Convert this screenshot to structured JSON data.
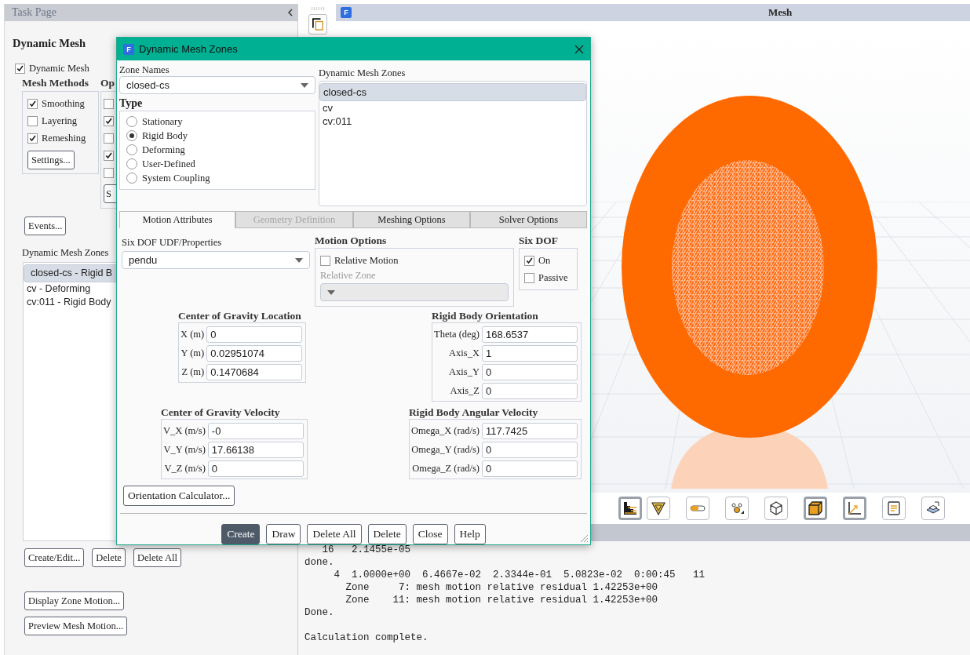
{
  "task_page": {
    "title": "Task Page",
    "heading": "Dynamic Mesh",
    "dynamic_mesh": {
      "label": "Dynamic Mesh",
      "checked": true
    },
    "mesh_methods": {
      "title": "Mesh Methods",
      "items": [
        {
          "label": "Smoothing",
          "checked": true
        },
        {
          "label": "Layering",
          "checked": false
        },
        {
          "label": "Remeshing",
          "checked": true
        }
      ],
      "button": "Settings..."
    },
    "options": {
      "title": "Op",
      "items": [
        {
          "checked": false
        },
        {
          "checked": true
        },
        {
          "checked": false
        },
        {
          "checked": true
        },
        {
          "checked": false
        }
      ],
      "button": "S"
    },
    "events_button": "Events...",
    "zones_label": "Dynamic Mesh Zones",
    "zones": [
      {
        "label": "closed-cs - Rigid B",
        "selected": true
      },
      {
        "label": "cv - Deforming",
        "selected": false
      },
      {
        "label": "cv:011 - Rigid Body",
        "selected": false
      }
    ],
    "zone_buttons": [
      "Create/Edit...",
      "Delete",
      "Delete All"
    ],
    "motion_buttons": [
      "Display Zone Motion...",
      "Preview Mesh Motion..."
    ]
  },
  "graphics": {
    "logo": "F",
    "title": "Mesh",
    "toolbar": [
      {
        "kind": "mesh",
        "selected": true
      },
      {
        "kind": "contour",
        "selected": false
      },
      {
        "kind": "slider",
        "selected": false
      },
      {
        "kind": "nodes",
        "selected": false
      },
      {
        "kind": "cube",
        "selected": false
      },
      {
        "kind": "box",
        "selected": true
      },
      {
        "kind": "axes",
        "selected": true
      },
      {
        "kind": "note",
        "selected": false
      },
      {
        "kind": "layers",
        "selected": false
      }
    ]
  },
  "console": {
    "blocks": [
      {
        "lines": [
          "   16   2.1455e-05",
          "done.",
          "     4  1.0000e+00  6.4667e-02  2.3344e-01  5.0823e-02  0:00:45   11",
          "       Zone     7: mesh motion relative residual 1.42253e+00",
          "       Zone    11: mesh motion relative residual 1.42253e+00",
          "Done."
        ]
      },
      {
        "lines": [
          "Calculation complete."
        ]
      }
    ]
  },
  "dialog": {
    "logo": "F",
    "title": "Dynamic Mesh Zones",
    "zone_names": {
      "label": "Zone Names",
      "value": "closed-cs"
    },
    "type": {
      "title": "Type",
      "options": [
        {
          "label": "Stationary",
          "selected": false
        },
        {
          "label": "Rigid Body",
          "selected": true
        },
        {
          "label": "Deforming",
          "selected": false
        },
        {
          "label": "User-Defined",
          "selected": false
        },
        {
          "label": "System Coupling",
          "selected": false
        }
      ]
    },
    "zones": {
      "label": "Dynamic Mesh Zones",
      "items": [
        {
          "label": "closed-cs",
          "selected": true
        },
        {
          "label": "cv",
          "selected": false
        },
        {
          "label": "cv:011",
          "selected": false
        }
      ]
    },
    "tabs": [
      {
        "label": "Motion Attributes",
        "selected": true,
        "disabled": false
      },
      {
        "label": "Geometry Definition",
        "selected": false,
        "disabled": true
      },
      {
        "label": "Meshing Options",
        "selected": false,
        "disabled": false
      },
      {
        "label": "Solver Options",
        "selected": false,
        "disabled": false
      }
    ],
    "six_dof_properties": {
      "label": "Six DOF UDF/Properties",
      "value": "pendu"
    },
    "motion_options": {
      "title": "Motion Options",
      "relative_motion": {
        "label": "Relative Motion",
        "checked": false
      },
      "relative_zone": {
        "label": "Relative Zone",
        "disabled": true
      }
    },
    "six_dof": {
      "title": "Six DOF",
      "items": [
        {
          "label": "On",
          "checked": true
        },
        {
          "label": "Passive",
          "checked": false
        }
      ]
    },
    "groups": [
      {
        "title": "Center of Gravity Location",
        "fields": [
          {
            "label": "X (m)",
            "value": "0"
          },
          {
            "label": "Y (m)",
            "value": "0.02951074"
          },
          {
            "label": "Z (m)",
            "value": "0.1470684"
          }
        ]
      },
      {
        "title": "Rigid Body Orientation",
        "fields": [
          {
            "label": "Theta (deg)",
            "value": "168.6537"
          },
          {
            "label": "Axis_X",
            "value": "1"
          },
          {
            "label": "Axis_Y",
            "value": "0"
          },
          {
            "label": "Axis_Z",
            "value": "0"
          }
        ]
      },
      {
        "title": "Center of Gravity Velocity",
        "fields": [
          {
            "label": "V_X (m/s)",
            "value": "-0"
          },
          {
            "label": "V_Y (m/s)",
            "value": "17.66138"
          },
          {
            "label": "V_Z (m/s)",
            "value": "0"
          }
        ]
      },
      {
        "title": "Rigid Body Angular Velocity",
        "fields": [
          {
            "label": "Omega_X (rad/s)",
            "value": "117.7425"
          },
          {
            "label": "Omega_Y (rad/s)",
            "value": "0"
          },
          {
            "label": "Omega_Z (rad/s)",
            "value": "0"
          }
        ]
      }
    ],
    "orientation_button": "Orientation Calculator...",
    "buttons": [
      {
        "label": "Create",
        "kind": "primary"
      },
      {
        "label": "Draw",
        "kind": "normal"
      },
      {
        "label": "Delete All",
        "kind": "normal"
      },
      {
        "label": "Delete",
        "kind": "normal"
      },
      {
        "label": "Close",
        "kind": "normal"
      },
      {
        "label": "Help",
        "kind": "normal"
      }
    ]
  }
}
